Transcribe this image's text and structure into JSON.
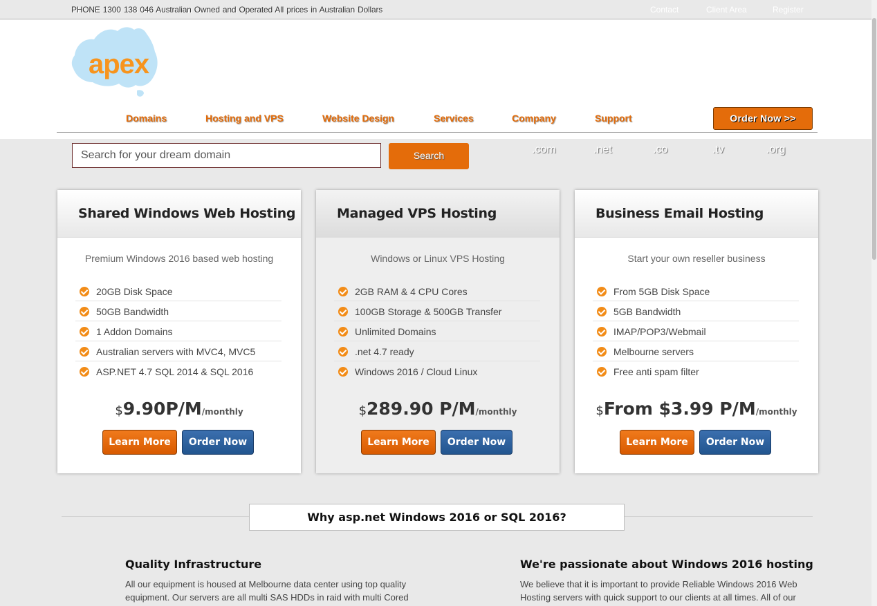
{
  "topbar": {
    "info": "PHONE 1300 138 046  Australian Owned and Operated  All prices in Australian Dollars",
    "links": [
      "Contact",
      "Client Area",
      "Register"
    ]
  },
  "brand": {
    "logo_text": "apex"
  },
  "nav": {
    "items": [
      "Domains",
      "Hosting and VPS",
      "Website Design",
      "Services",
      "Company",
      "Support"
    ],
    "order_button": "Order Now >>"
  },
  "search": {
    "placeholder": "Search for your dream domain",
    "button": "Search",
    "tlds": [
      ".com",
      ".net",
      ".co",
      ".tv",
      ".org"
    ]
  },
  "plans": [
    {
      "title": "Shared Windows Web Hosting",
      "subtitle": "Premium Windows 2016 based web hosting",
      "features": [
        "20GB Disk Space",
        "50GB Bandwidth",
        "1 Addon Domains",
        "Australian servers with MVC4, MVC5",
        "ASP.NET 4.7 SQL 2014 & SQL 2016"
      ],
      "currency": "$",
      "price": "9.90P/M",
      "period": "/monthly",
      "learn": "Learn More",
      "order": "Order Now"
    },
    {
      "title": "Managed VPS Hosting",
      "subtitle": "Windows or Linux VPS Hosting",
      "features": [
        "2GB RAM & 4 CPU Cores",
        "100GB Storage & 500GB Transfer",
        "Unlimited Domains",
        ".net 4.7 ready",
        "Windows 2016 / Cloud Linux"
      ],
      "currency": "$",
      "price": "289.90 P/M",
      "period": "/monthly",
      "learn": "Learn More",
      "order": "Order Now"
    },
    {
      "title": "Business Email Hosting",
      "subtitle": "Start your own reseller business",
      "features": [
        "From 5GB Disk Space",
        "5GB Bandwidth",
        "IMAP/POP3/Webmail",
        "Melbourne servers",
        "Free anti spam filter"
      ],
      "currency": "$",
      "price": "From $3.99 P/M",
      "period": "/monthly",
      "learn": "Learn More",
      "order": "Order Now"
    }
  ],
  "why": {
    "title": "Why asp.net Windows 2016 or SQL 2016?",
    "left_title": "Quality Infrastructure",
    "left_text": "All our equipment is housed at Melbourne data center using top quality equipment. Our servers are all multi SAS HDDs in raid with multi Cored",
    "right_title": "We're passionate about Windows 2016 hosting",
    "right_text": "We believe that it is important to provide Reliable Windows 2016 Web Hosting servers with quick support to our clients at all times. All of our"
  },
  "colors": {
    "accent": "#e46c0a",
    "blue": "#2a5f9e",
    "logo_bg": "#bfe3f7"
  }
}
